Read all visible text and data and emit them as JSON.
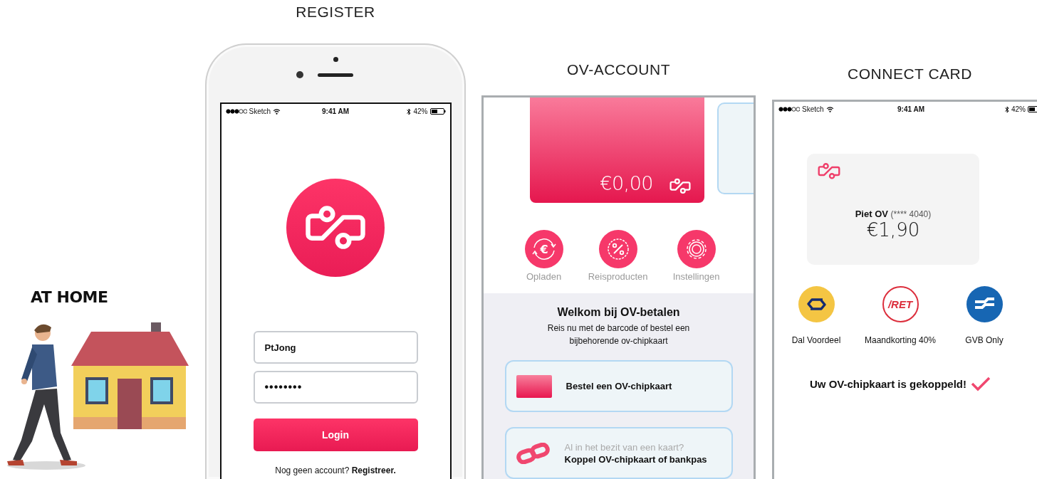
{
  "at_home": {
    "title": "AT HOME"
  },
  "register": {
    "heading": "REGISTER",
    "status_bar": {
      "carrier": "Sketch",
      "time": "9:41 AM",
      "battery": "42%"
    },
    "username": {
      "value": "PtJong"
    },
    "password": {
      "value": "••••••••"
    },
    "login_button": "Login",
    "register_prompt": "Nog geen account? **Registreer.**"
  },
  "ov_account": {
    "heading": "OV-ACCOUNT",
    "balance": "€0,00",
    "actions": [
      {
        "kind": "topup",
        "glyph": "€",
        "label": "Opladen"
      },
      {
        "kind": "products",
        "label": "Reisproducten"
      },
      {
        "kind": "settings",
        "label": "Instellingen"
      }
    ],
    "welcome": {
      "title": "Welkom bij OV-betalen",
      "text": "Reis nu met de barcode of bestel een bijbehorende ov-chipkaart"
    },
    "options": [
      {
        "kind": "order",
        "title": "Bestel een OV-chipkaart"
      },
      {
        "kind": "link",
        "hint": "Al in het bezit van een kaart?",
        "title": "Koppel OV-chipkaart of bankpas"
      }
    ]
  },
  "connect_card": {
    "heading": "CONNECT CARD",
    "status_bar": {
      "carrier": "Sketch",
      "time": "9:41 AM",
      "battery": "42%"
    },
    "card": {
      "holder": "Piet OV",
      "number": "(**** 4040)",
      "balance": "€1,90"
    },
    "products": [
      {
        "kind": "ns",
        "label": "Dal Voordeel"
      },
      {
        "kind": "ret",
        "logo": "/RET",
        "label": "Maandkorting 40%"
      },
      {
        "kind": "gvb",
        "label": "GVB Only"
      }
    ],
    "message": "Uw OV-chipkaart is gekoppeld!"
  }
}
